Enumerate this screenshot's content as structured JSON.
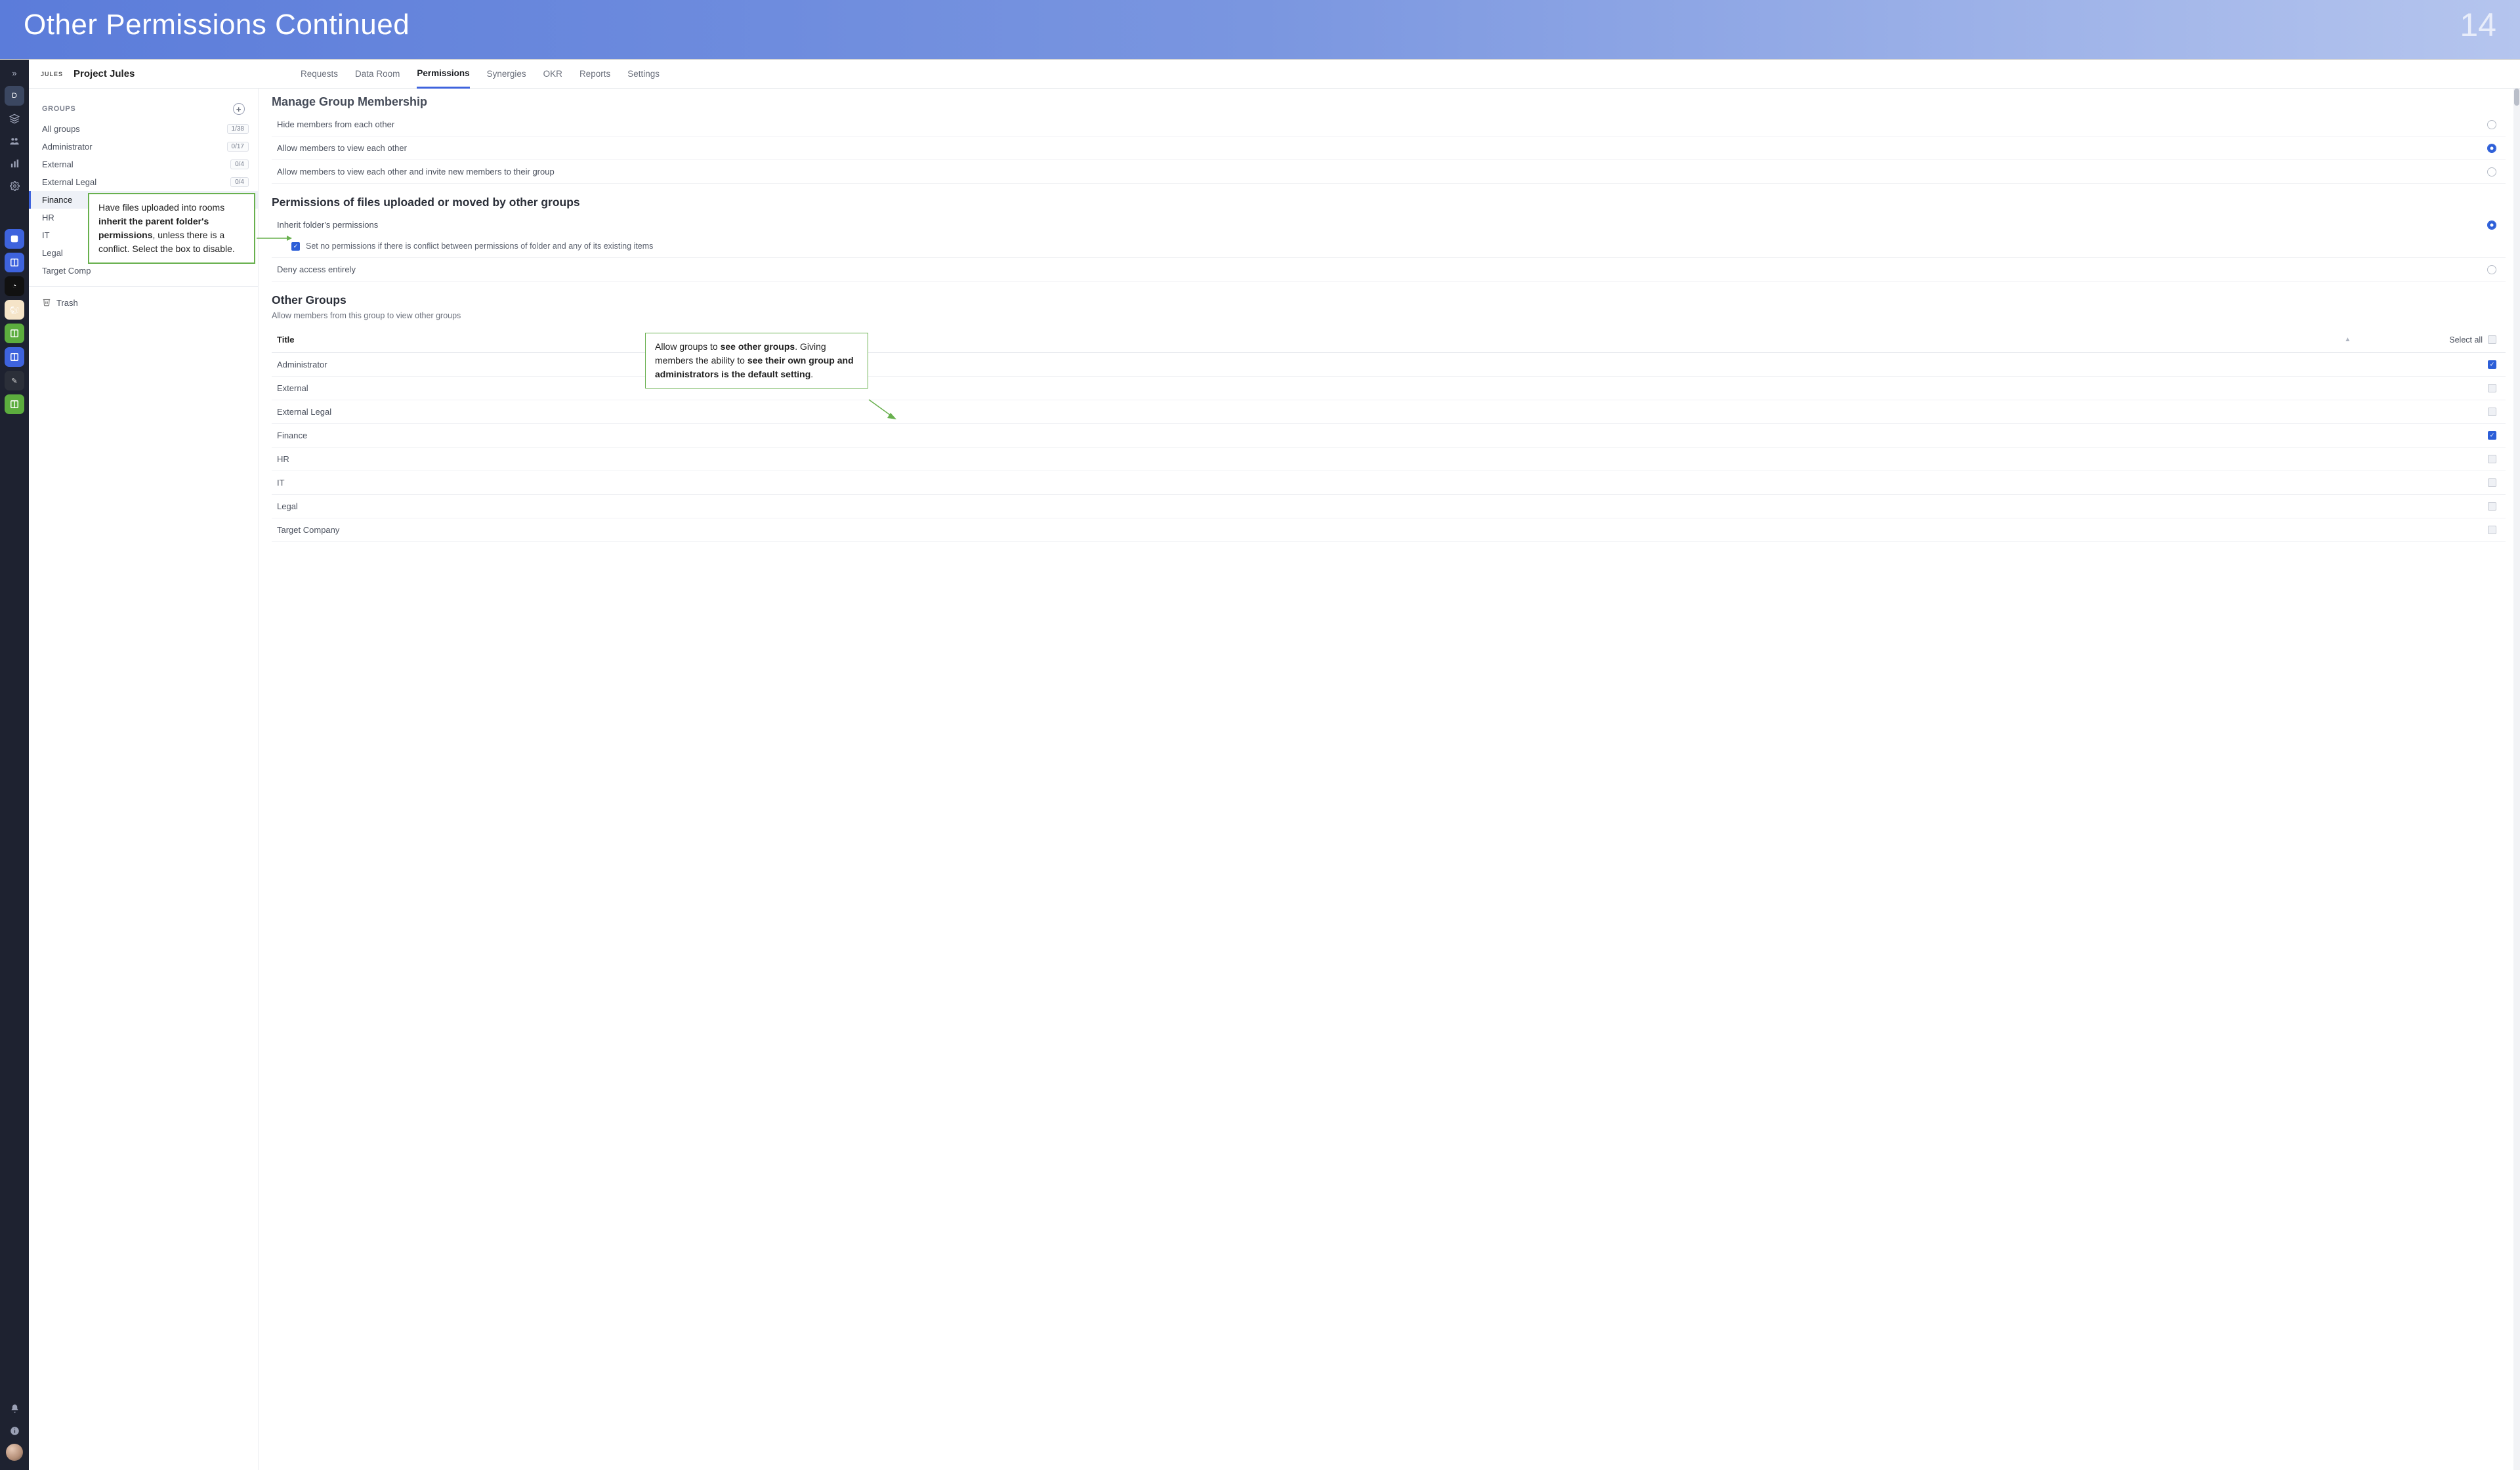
{
  "slide": {
    "title": "Other Permissions Continued",
    "number": "14"
  },
  "rail": {
    "expand": "»",
    "badge": "D"
  },
  "project": {
    "logo": "JULES",
    "name": "Project Jules"
  },
  "tabs": [
    {
      "label": "Requests",
      "active": false
    },
    {
      "label": "Data Room",
      "active": false
    },
    {
      "label": "Permissions",
      "active": true
    },
    {
      "label": "Synergies",
      "active": false
    },
    {
      "label": "OKR",
      "active": false
    },
    {
      "label": "Reports",
      "active": false
    },
    {
      "label": "Settings",
      "active": false
    }
  ],
  "sidebar": {
    "header": "GROUPS",
    "groups": [
      {
        "name": "All groups",
        "count": "1/38",
        "selected": false
      },
      {
        "name": "Administrator",
        "count": "0/17",
        "selected": false
      },
      {
        "name": "External",
        "count": "0/4",
        "selected": false
      },
      {
        "name": "External Legal",
        "count": "0/4",
        "selected": false
      },
      {
        "name": "Finance",
        "count": "",
        "selected": true
      },
      {
        "name": "HR",
        "count": "",
        "selected": false
      },
      {
        "name": "IT",
        "count": "",
        "selected": false
      },
      {
        "name": "Legal",
        "count": "",
        "selected": false
      },
      {
        "name": "Target Comp",
        "count": "",
        "selected": false
      }
    ],
    "trash": "Trash"
  },
  "sections": {
    "manage_membership_title": "Manage Group Membership",
    "membership_options": [
      {
        "label": "Hide members from each other",
        "checked": false
      },
      {
        "label": "Allow members to view each other",
        "checked": true
      },
      {
        "label": "Allow members to view each other and invite new members to their group",
        "checked": false
      }
    ],
    "perm_files_title": "Permissions of files uploaded or moved by other groups",
    "perm_files_options": {
      "inherit": {
        "label": "Inherit folder's permissions",
        "checked": true
      },
      "conflict_sub": "Set no permissions if there is conflict between permissions of folder and any of its existing items",
      "deny": {
        "label": "Deny access entirely",
        "checked": false
      }
    },
    "other_groups_title": "Other Groups",
    "other_groups_sub": "Allow members from this group to view other groups",
    "table": {
      "th_title": "Title",
      "select_all": "Select all",
      "rows": [
        {
          "name": "Administrator",
          "checked": true
        },
        {
          "name": "External",
          "checked": false
        },
        {
          "name": "External Legal",
          "checked": false
        },
        {
          "name": "Finance",
          "checked": true
        },
        {
          "name": "HR",
          "checked": false
        },
        {
          "name": "IT",
          "checked": false
        },
        {
          "name": "Legal",
          "checked": false
        },
        {
          "name": "Target Company",
          "checked": false
        }
      ]
    }
  },
  "callouts": {
    "c1_a": "Have files uploaded into rooms ",
    "c1_b": "inherit the parent folder's permissions",
    "c1_c": ", unless there is a conflict. Select the box to disable.",
    "c2_a": "Allow groups to ",
    "c2_b": "see other groups",
    "c2_c": ". Giving members the ability to ",
    "c2_d": "see their own group and administrators is the default setting",
    "c2_e": "."
  }
}
